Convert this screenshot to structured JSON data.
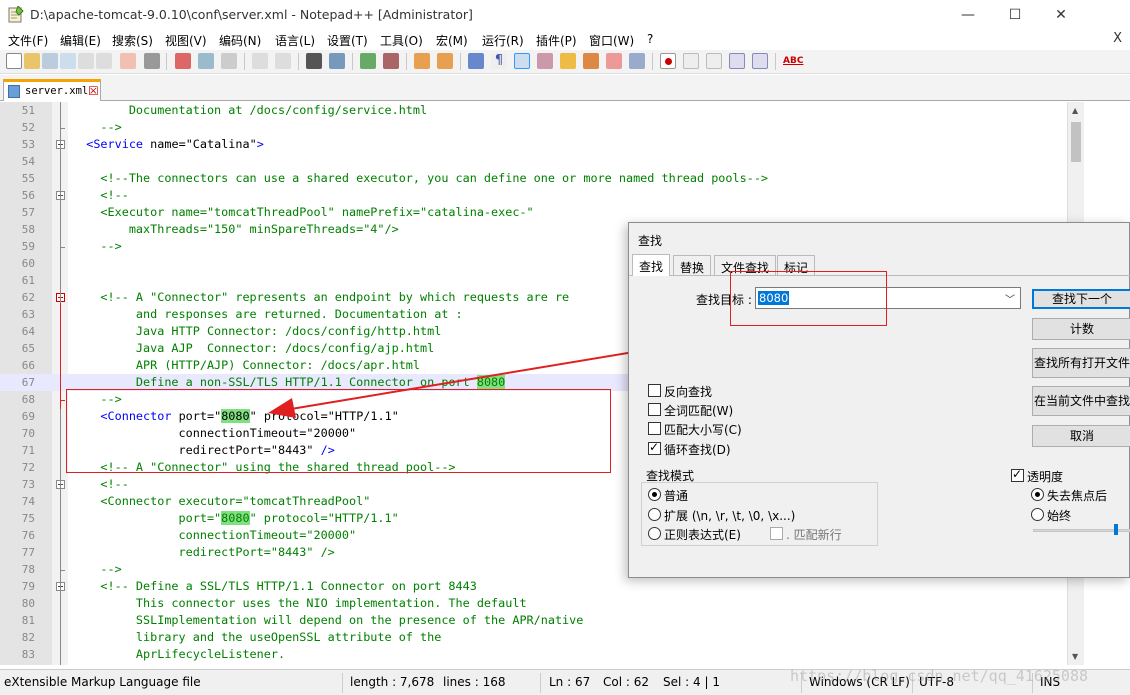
{
  "window": {
    "title": "D:\\apache-tomcat-9.0.10\\conf\\server.xml - Notepad++ [Administrator]",
    "minimize_glyph": "—",
    "maximize_glyph": "☐",
    "close_glyph": "✕"
  },
  "menu": {
    "items": [
      "文件(F)",
      "编辑(E)",
      "搜索(S)",
      "视图(V)",
      "编码(N)",
      "语言(L)",
      "设置(T)",
      "工具(O)",
      "宏(M)",
      "运行(R)",
      "插件(P)",
      "窗口(W)",
      "?"
    ],
    "close_x": "X"
  },
  "toolbar": {
    "icons": [
      "new-file-icon",
      "open-file-icon",
      "save-icon",
      "save-all-icon",
      "close-icon",
      "close-all-icon",
      "print-icon",
      "cut-icon",
      "copy-icon",
      "paste-icon",
      "undo-icon",
      "redo-icon",
      "find-icon",
      "replace-icon",
      "zoom-in-icon",
      "zoom-out-icon",
      "sync-v-icon",
      "sync-h-icon",
      "word-wrap-icon",
      "all-chars-icon",
      "indent-guide-icon",
      "doc-map-icon",
      "function-list-icon",
      "folder-workspace-icon",
      "monitor-icon",
      "record-macro-icon",
      "stop-record-icon",
      "play-macro-icon",
      "run-macro-multiple-icon",
      "save-macro-icon",
      "spell-check-icon"
    ],
    "spell_check_text": "ABC"
  },
  "tab": {
    "label": "server.xml",
    "close_glyph": "☒"
  },
  "editor": {
    "lines": [
      {
        "n": "51",
        "t": "        Documentation at /docs/config/service.html"
      },
      {
        "n": "52",
        "t": "    -->"
      },
      {
        "n": "53",
        "t": "  <Service name=\"Catalina\">"
      },
      {
        "n": "54",
        "t": ""
      },
      {
        "n": "55",
        "t": "    <!--The connectors can use a shared executor, you can define one or more named thread pools-->"
      },
      {
        "n": "56",
        "t": "    <!--"
      },
      {
        "n": "57",
        "t": "    <Executor name=\"tomcatThreadPool\" namePrefix=\"catalina-exec-\""
      },
      {
        "n": "58",
        "t": "        maxThreads=\"150\" minSpareThreads=\"4\"/>"
      },
      {
        "n": "59",
        "t": "    -->"
      },
      {
        "n": "60",
        "t": ""
      },
      {
        "n": "61",
        "t": ""
      },
      {
        "n": "62",
        "t": "    <!-- A \"Connector\" represents an endpoint by which requests are re"
      },
      {
        "n": "63",
        "t": "         and responses are returned. Documentation at :"
      },
      {
        "n": "64",
        "t": "         Java HTTP Connector: /docs/config/http.html"
      },
      {
        "n": "65",
        "t": "         Java AJP  Connector: /docs/config/ajp.html"
      },
      {
        "n": "66",
        "t": "         APR (HTTP/AJP) Connector: /docs/apr.html"
      },
      {
        "n": "67",
        "t": "         Define a non-SSL/TLS HTTP/1.1 Connector on port 8080"
      },
      {
        "n": "68",
        "t": "    -->"
      },
      {
        "n": "69",
        "t": "    <Connector port=\"8080\" protocol=\"HTTP/1.1\""
      },
      {
        "n": "70",
        "t": "               connectionTimeout=\"20000\""
      },
      {
        "n": "71",
        "t": "               redirectPort=\"8443\" />"
      },
      {
        "n": "72",
        "t": "    <!-- A \"Connector\" using the shared thread pool-->"
      },
      {
        "n": "73",
        "t": "    <!--"
      },
      {
        "n": "74",
        "t": "    <Connector executor=\"tomcatThreadPool\""
      },
      {
        "n": "75",
        "t": "               port=\"8080\" protocol=\"HTTP/1.1\""
      },
      {
        "n": "76",
        "t": "               connectionTimeout=\"20000\""
      },
      {
        "n": "77",
        "t": "               redirectPort=\"8443\" />"
      },
      {
        "n": "78",
        "t": "    -->"
      },
      {
        "n": "79",
        "t": "    <!-- Define a SSL/TLS HTTP/1.1 Connector on port 8443"
      },
      {
        "n": "80",
        "t": "         This connector uses the NIO implementation. The default"
      },
      {
        "n": "81",
        "t": "         SSLImplementation will depend on the presence of the APR/native"
      },
      {
        "n": "82",
        "t": "         library and the useOpenSSL attribute of the"
      },
      {
        "n": "83",
        "t": "         AprLifecycleListener."
      }
    ]
  },
  "find_dialog": {
    "title": "查找",
    "tabs": [
      "查找",
      "替换",
      "文件查找",
      "标记"
    ],
    "find_label": "查找目标 :",
    "find_value": "8080",
    "buttons": [
      "查找下一个",
      "计数",
      "查找所有打开文件",
      "在当前文件中查找",
      "取消"
    ],
    "checkboxes": [
      {
        "label": "反向查找",
        "checked": false
      },
      {
        "label": "全词匹配(W)",
        "checked": false
      },
      {
        "label": "匹配大小写(C)",
        "checked": false
      },
      {
        "label": "循环查找(D)",
        "checked": true
      }
    ],
    "search_mode_label": "查找模式",
    "modes": [
      {
        "label": "普通",
        "checked": true
      },
      {
        "label": "扩展 (\\n, \\r, \\t, \\0, \\x...)",
        "checked": false
      },
      {
        "label": "正则表达式(E)",
        "checked": false
      }
    ],
    "dot_newline_label": ". 匹配新行",
    "transparency_label": "透明度",
    "transparency_checked": true,
    "transparency_modes": [
      {
        "label": "失去焦点后",
        "checked": true
      },
      {
        "label": "始终",
        "checked": false
      }
    ]
  },
  "status": {
    "file_type": "eXtensible Markup Language file",
    "length": "length : 7,678",
    "lines": "lines : 168",
    "ln": "Ln : 67",
    "col": "Col : 62",
    "sel": "Sel : 4 | 1",
    "eol": "Windows (CR LF)",
    "encoding": "UTF-8",
    "mode": "INS"
  },
  "watermark": "https://blog.csdn.net/qq_41625088",
  "colors": {
    "comment": "#008000",
    "tag": "#0000ff",
    "attribute": "#ff0000",
    "value": "#8000ff",
    "match_highlight": "#80e080",
    "current_line": "#e8e8ff",
    "annotation_red": "#e02020"
  }
}
